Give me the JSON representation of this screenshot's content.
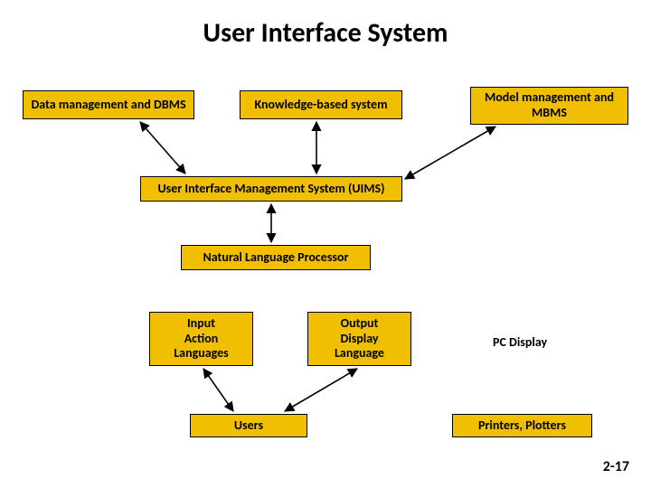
{
  "title": "User Interface System",
  "boxes": {
    "data_mgmt": "Data management and DBMS",
    "knowledge": "Knowledge-based system",
    "model_mgmt": "Model management and MBMS",
    "uims": "User Interface Management System (UIMS)",
    "nlp": "Natural Language Processor",
    "input_lang": "Input\nAction\nLanguages",
    "output_lang": "Output\nDisplay\nLanguage",
    "users": "Users",
    "printers": "Printers, Plotters"
  },
  "labels": {
    "pc_display": "PC Display"
  },
  "slide_number": "2-17"
}
